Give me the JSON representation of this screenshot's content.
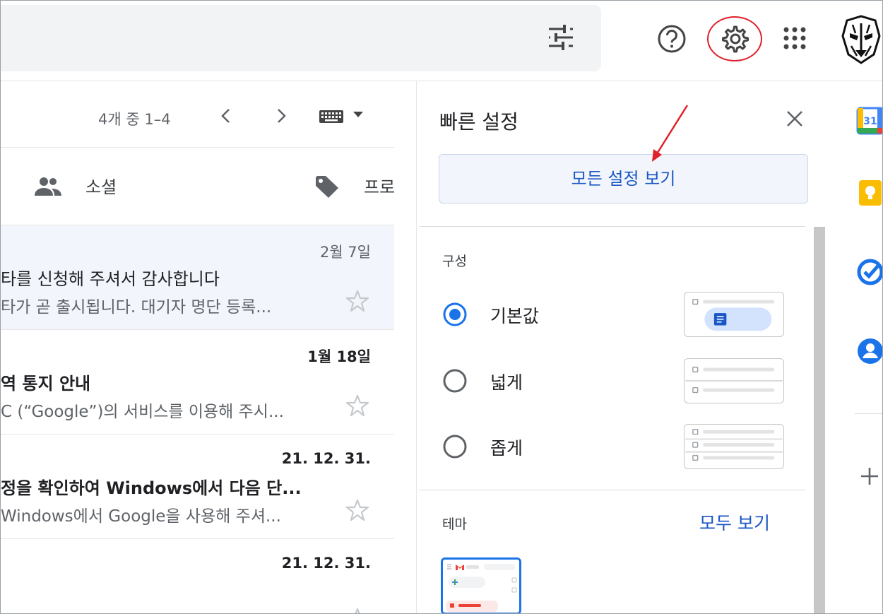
{
  "toolbar": {
    "page_count": "4개 중 1–4"
  },
  "tabs": {
    "social": "소셜",
    "promotions": "프로"
  },
  "emails": [
    {
      "date": "2월 7일",
      "subject": "타를 신청해 주셔서 감사합니다",
      "snippet": "타가 곧 출시됩니다. 대기자 명단 등록...",
      "read": true
    },
    {
      "date": "1월 18일",
      "subject": "역 통지 안내",
      "snippet": "C (“Google”)의 서비스를 이용해 주시...",
      "read": false
    },
    {
      "date": "21. 12. 31.",
      "subject": "정을 확인하여 Windows에서 다음 단...",
      "snippet": "Windows에서 Google을 사용해 주셔...",
      "read": false
    },
    {
      "date": "21. 12. 31.",
      "subject": "",
      "snippet": "",
      "read": false
    }
  ],
  "quick_settings": {
    "title": "빠른 설정",
    "all_settings_button": "모든 설정 보기",
    "density_label": "구성",
    "density_options": [
      {
        "label": "기본값",
        "selected": true
      },
      {
        "label": "넓게",
        "selected": false
      },
      {
        "label": "좁게",
        "selected": false
      }
    ],
    "theme_label": "테마",
    "view_all": "모두 보기"
  },
  "side_apps": [
    "calendar-icon",
    "keep-icon",
    "tasks-icon",
    "contacts-icon"
  ],
  "colors": {
    "accent": "#1a73e8",
    "link": "#1a56c4",
    "highlight_circle": "#e0202a"
  }
}
